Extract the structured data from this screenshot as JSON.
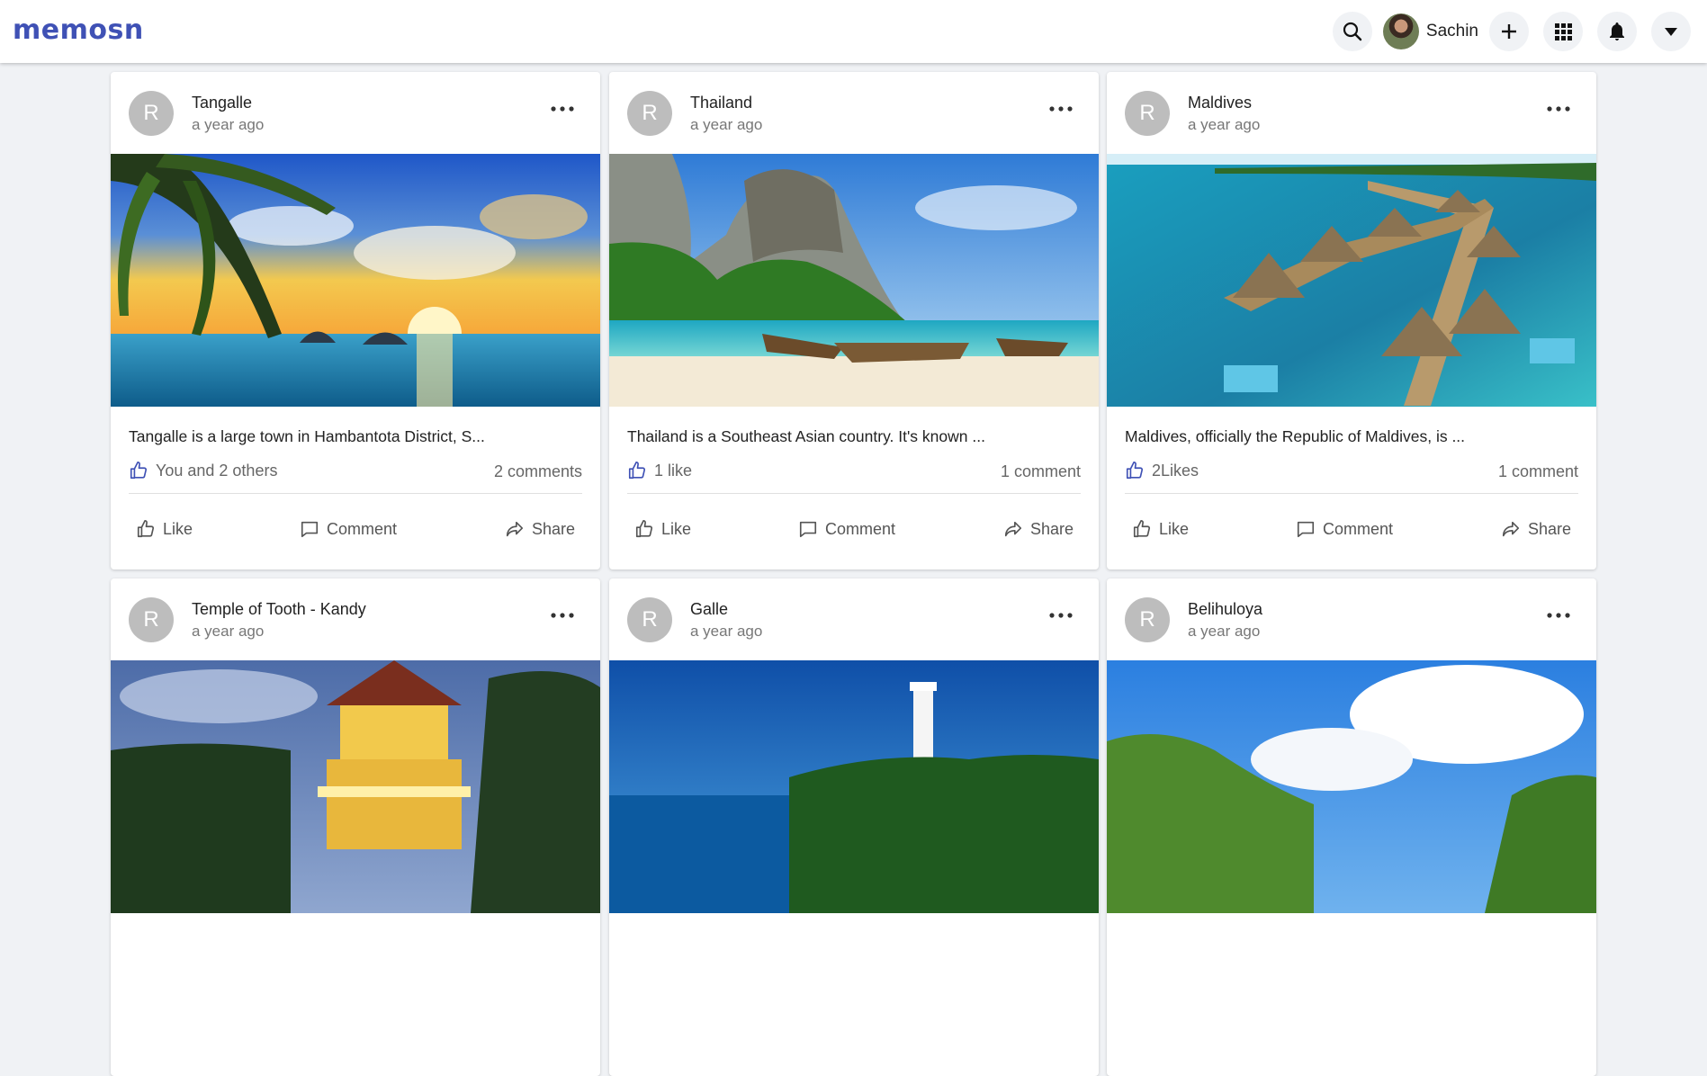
{
  "app": {
    "logo": "memosn"
  },
  "topbar": {
    "search_icon": "search-icon",
    "user_name": "Sachin",
    "add_icon": "plus-icon",
    "apps_icon": "grid-icon",
    "notifications_icon": "bell-icon",
    "menu_icon": "caret-down-icon"
  },
  "actions": {
    "like": "Like",
    "comment": "Comment",
    "share": "Share"
  },
  "posts": [
    {
      "avatar": "R",
      "title": "Tangalle",
      "time": "a year ago",
      "text": "Tangalle is a large town in Hambantota District, S...",
      "likes": "You and 2 others",
      "comments": "2 comments"
    },
    {
      "avatar": "R",
      "title": "Thailand",
      "time": "a year ago",
      "text": "Thailand is a Southeast Asian country. It's known ...",
      "likes": "1 like",
      "comments": "1 comment"
    },
    {
      "avatar": "R",
      "title": "Maldives",
      "time": "a year ago",
      "text": "Maldives, officially the Republic of Maldives, is ...",
      "likes": "2Likes",
      "comments": "1 comment"
    },
    {
      "avatar": "R",
      "title": "Temple of Tooth - Kandy",
      "time": "a year ago",
      "text": "",
      "likes": "",
      "comments": ""
    },
    {
      "avatar": "R",
      "title": "Galle",
      "time": "a year ago",
      "text": "",
      "likes": "",
      "comments": ""
    },
    {
      "avatar": "R",
      "title": "Belihuloya",
      "time": "a year ago",
      "text": "",
      "likes": "",
      "comments": ""
    }
  ],
  "colors": {
    "brand": "#3f51b5",
    "like_icon": "#3f51b5",
    "background": "#f0f2f5"
  }
}
